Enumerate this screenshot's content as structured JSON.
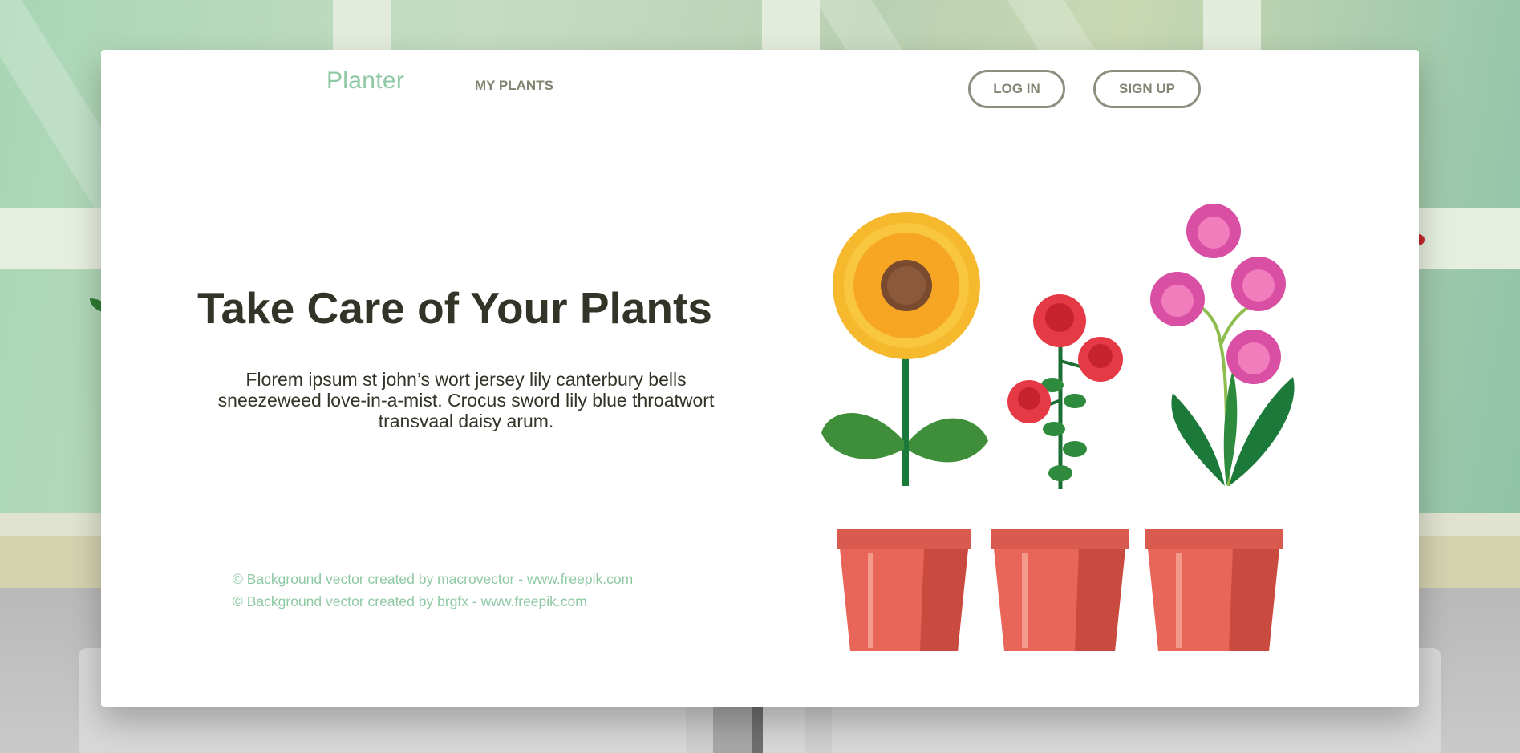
{
  "header": {
    "brand": "Planter",
    "nav_my_plants": "MY PLANTS",
    "login_label": "LOG IN",
    "signup_label": "SIGN UP"
  },
  "hero": {
    "title": "Take Care of Your Plants",
    "text": "Florem ipsum st john’s wort jersey lily canterbury bells sneezeweed love-in-a-mist. Crocus sword lily blue throatwort transvaal daisy arum."
  },
  "credits": [
    "© Background vector created by macrovector - www.freepik.com",
    "© Background vector created by brgfx - www.freepik.com"
  ],
  "illustration": {
    "plants": [
      "sunflower",
      "roses",
      "orchid"
    ]
  },
  "colors": {
    "brand": "#8ec9a4",
    "text_dark": "#333327",
    "muted": "#838372",
    "pot": "#e8655a",
    "pot_dark": "#c94b3f"
  }
}
